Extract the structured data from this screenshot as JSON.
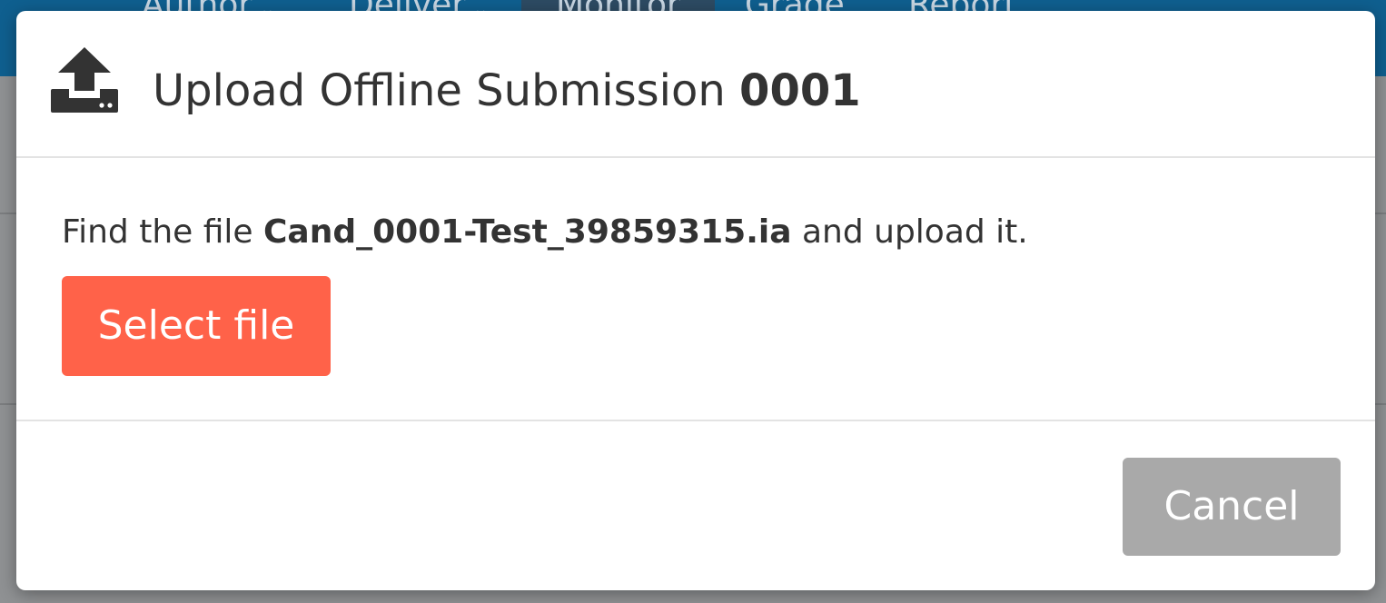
{
  "background": {
    "nav": [
      {
        "label": "Author",
        "has_chevron": true
      },
      {
        "label": "Deliver",
        "has_chevron": true
      },
      {
        "label": "Monitor",
        "active": true
      },
      {
        "label": "Grade"
      },
      {
        "label": "Report"
      }
    ],
    "chevron": "⌄"
  },
  "dialog": {
    "icon": "upload-icon",
    "title_prefix": "Upload Offline Submission",
    "title_id": "0001",
    "instruction_prefix": "Find the file",
    "file_name": "Cand_0001-Test_39859315.ia",
    "instruction_suffix": "and upload it.",
    "select_button_label": "Select file",
    "cancel_button_label": "Cancel"
  },
  "colors": {
    "primary_button": "#ff6249",
    "cancel_button": "#a9a9a9",
    "topbar": "#0f5f8f"
  }
}
